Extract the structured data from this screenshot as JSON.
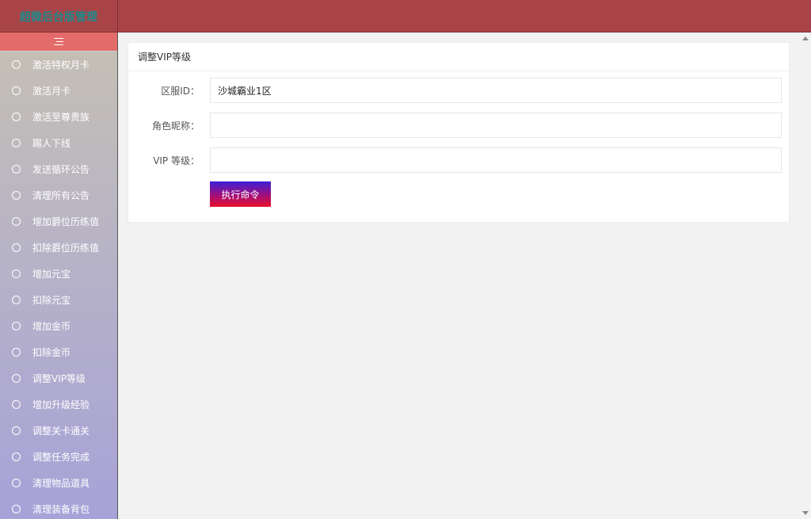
{
  "header": {
    "logo_text": "超微后台版管理"
  },
  "sidebar": {
    "items": [
      {
        "label": "激活特权月卡"
      },
      {
        "label": "激活月卡"
      },
      {
        "label": "激活至尊贵族"
      },
      {
        "label": "踢人下线"
      },
      {
        "label": "发送循环公告"
      },
      {
        "label": "清理所有公告"
      },
      {
        "label": "增加爵位历练值"
      },
      {
        "label": "扣除爵位历练值"
      },
      {
        "label": "增加元宝"
      },
      {
        "label": "扣除元宝"
      },
      {
        "label": "增加金币"
      },
      {
        "label": "扣除金币"
      },
      {
        "label": "调整VIP等级"
      },
      {
        "label": "增加升级经验"
      },
      {
        "label": "调整关卡通关"
      },
      {
        "label": "调整任务完成"
      },
      {
        "label": "清理物品道具"
      },
      {
        "label": "清理装备背包"
      }
    ]
  },
  "panel": {
    "title": "调整VIP等级",
    "fields": [
      {
        "label": "区服ID：",
        "value": "沙城霸业1区",
        "placeholder": ""
      },
      {
        "label": "角色昵称：",
        "value": "",
        "placeholder": ""
      },
      {
        "label": "VIP 等级：",
        "value": "",
        "placeholder": ""
      }
    ],
    "submit_label": "执行命令"
  },
  "colors": {
    "topbar": "#a84447",
    "toggle_bar": "#e36b6a",
    "logo_text": "#1e8a8c"
  }
}
